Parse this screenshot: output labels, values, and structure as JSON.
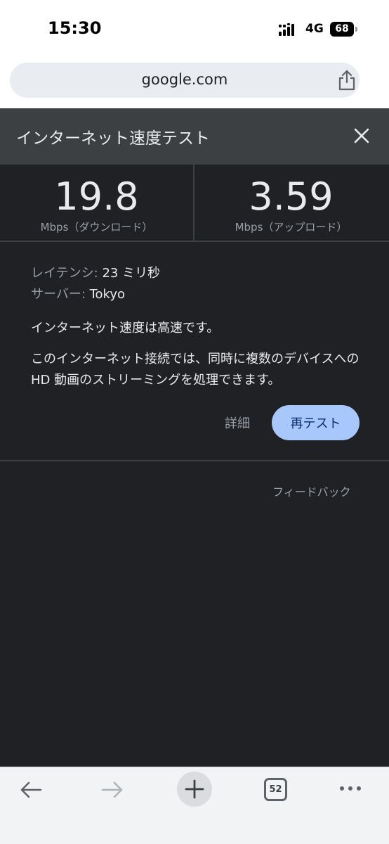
{
  "status_bar": {
    "time": "15:30",
    "network": "4G",
    "battery": "68"
  },
  "browser": {
    "url": "google.com",
    "tab_count": "52"
  },
  "speed_test": {
    "title": "インターネット速度テスト",
    "download": {
      "value": "19.8",
      "label": "Mbps（ダウンロード）"
    },
    "upload": {
      "value": "3.59",
      "label": "Mbps（アップロード）"
    },
    "latency_label": "レイテンシ: ",
    "latency_value": "23 ミリ秒",
    "server_label": "サーバー: ",
    "server_value": "Tokyo",
    "summary": "インターネット速度は高速です。",
    "description": "このインターネット接続では、同時に複数のデバイスへの HD 動画のストリーミングを処理できます。",
    "details_label": "詳細",
    "retest_label": "再テスト",
    "feedback_label": "フィードバック"
  },
  "colors": {
    "panel_bg": "#202124",
    "header_bg": "#3c4043",
    "accent_button": "#a8c7fa"
  }
}
